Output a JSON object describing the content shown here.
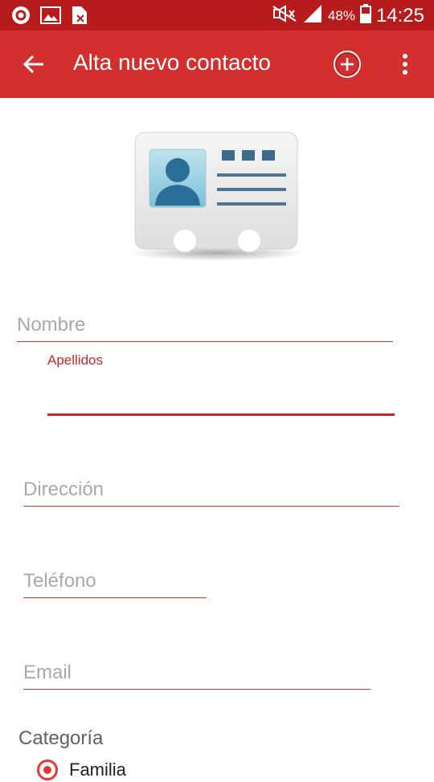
{
  "status_bar": {
    "battery": "48%",
    "time": "14:25"
  },
  "app_bar": {
    "title": "Alta nuevo contacto",
    "back_icon": "arrow-back-icon",
    "add_icon": "add-circle-icon",
    "menu_icon": "more-vert-icon"
  },
  "form": {
    "nombre_placeholder": "Nombre",
    "apellidos_label": "Apellidos",
    "apellidos_value": "",
    "direccion_placeholder": "Dirección",
    "telefono_placeholder": "Teléfono",
    "email_placeholder": "Email",
    "categoria_label": "Categoría",
    "categoria_options": [
      {
        "label": "Familia",
        "selected": true
      }
    ]
  },
  "colors": {
    "statusbar": "#b71c1c",
    "appbar": "#d32f2f",
    "accent": "#c62828"
  }
}
